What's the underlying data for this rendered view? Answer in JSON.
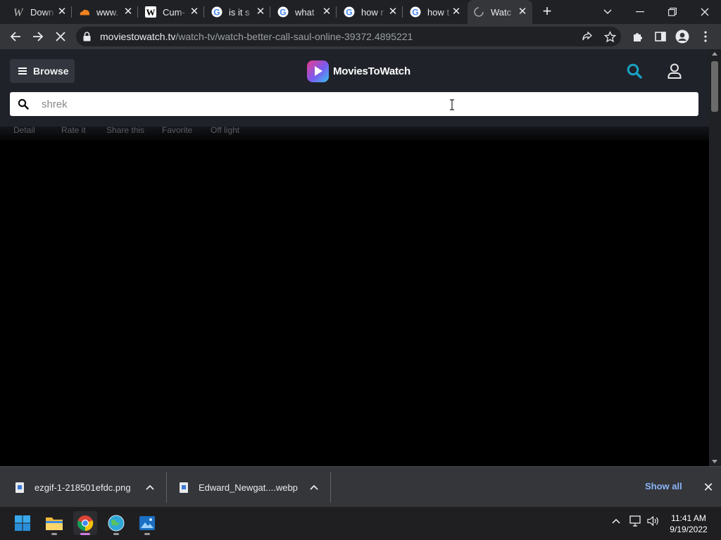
{
  "browser": {
    "tabs": [
      {
        "title": "Down",
        "icon": "wiktionary-w-icon",
        "active": false
      },
      {
        "title": "www.",
        "icon": "cloud-favicon-icon",
        "active": false
      },
      {
        "title": "Cum-",
        "icon": "wikipedia-w-icon",
        "active": false
      },
      {
        "title": "is it s",
        "icon": "google-icon",
        "active": false
      },
      {
        "title": "what",
        "icon": "google-icon",
        "active": false
      },
      {
        "title": "how r",
        "icon": "google-icon",
        "active": false
      },
      {
        "title": "how t",
        "icon": "google-icon",
        "active": false
      },
      {
        "title": "Watc",
        "icon": "loading-spinner-icon",
        "active": true
      }
    ],
    "address": {
      "host": "moviestowatch.tv",
      "path": "/watch-tv/watch-better-call-saul-online-39372.4895221"
    }
  },
  "site": {
    "browse_label": "Browse",
    "logo_text": "MoviesToWatch",
    "search": {
      "value": "shrek"
    },
    "detail_links": [
      "Detail",
      "Rate it",
      "Share this",
      "Favorite",
      "Off light"
    ]
  },
  "downloads": {
    "items": [
      {
        "name": "ezgif-1-218501efdc.png"
      },
      {
        "name": "Edward_Newgat....webp"
      }
    ],
    "show_all_label": "Show all"
  },
  "taskbar": {
    "time": "11:41 AM",
    "date": "9/19/2022",
    "apps": [
      "start-icon",
      "file-explorer-icon",
      "chrome-icon",
      "network-globe-icon",
      "photos-icon"
    ]
  },
  "colors": {
    "accent_search": "#17a2c4",
    "page_background": "#000000",
    "header_background": "#20222a",
    "chrome_dark": "#202124",
    "chrome_toolbar": "#35363a",
    "link_blue": "#8ab4f8"
  }
}
